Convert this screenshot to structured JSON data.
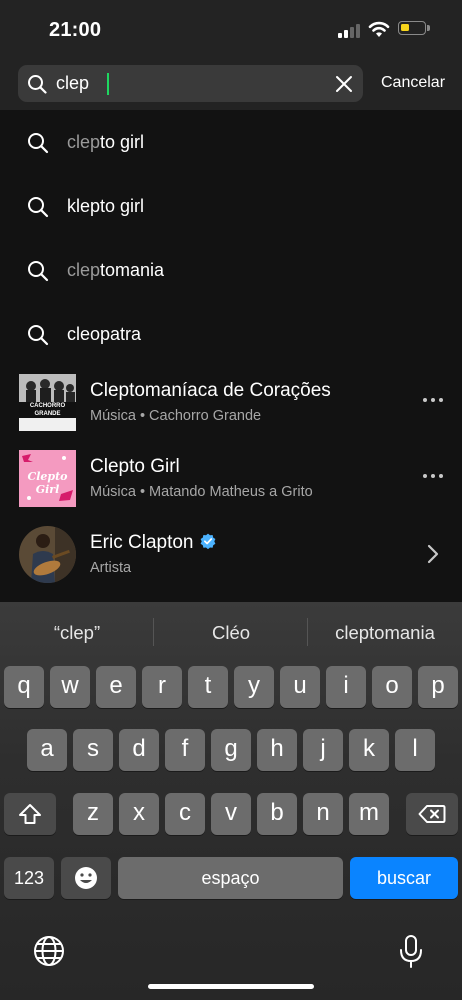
{
  "status_bar": {
    "time": "21:00",
    "icons": [
      "cellular-signal-icon",
      "wifi-icon",
      "battery-icon"
    ],
    "battery_color": "#f7d51c"
  },
  "search": {
    "value": "clep",
    "placeholder": "",
    "cancel_label": "Cancelar",
    "caret_color": "#1ed760"
  },
  "suggestions": [
    {
      "match": "clep",
      "rest": "to girl"
    },
    {
      "match": "",
      "rest": "klepto girl"
    },
    {
      "match": "clep",
      "rest": "tomania"
    },
    {
      "match": "",
      "rest": "cleopatra"
    }
  ],
  "items": [
    {
      "title": "Cleptomaníaca de Corações",
      "subtitle": "Música • Cachorro Grande",
      "thumb_text": "CACHORRO GRANDE",
      "action": "more-options-icon"
    },
    {
      "title": "Clepto Girl",
      "subtitle": "Música • Matando Matheus a Grito",
      "thumb_text": "Clepto Girl",
      "action": "more-options-icon"
    },
    {
      "title": "Eric Clapton",
      "subtitle": "Artista",
      "verified": true,
      "action": "chevron-right-icon"
    }
  ],
  "keyboard": {
    "predictions": [
      "“clep”",
      "Cléo",
      "cleptomania"
    ],
    "row1": [
      "q",
      "w",
      "e",
      "r",
      "t",
      "y",
      "u",
      "i",
      "o",
      "p"
    ],
    "row2": [
      "a",
      "s",
      "d",
      "f",
      "g",
      "h",
      "j",
      "k",
      "l"
    ],
    "row3": [
      "z",
      "x",
      "c",
      "v",
      "b",
      "n",
      "m"
    ],
    "numbers_label": "123",
    "space_label": "espaço",
    "search_label": "buscar",
    "accent_color": "#0a84ff"
  }
}
